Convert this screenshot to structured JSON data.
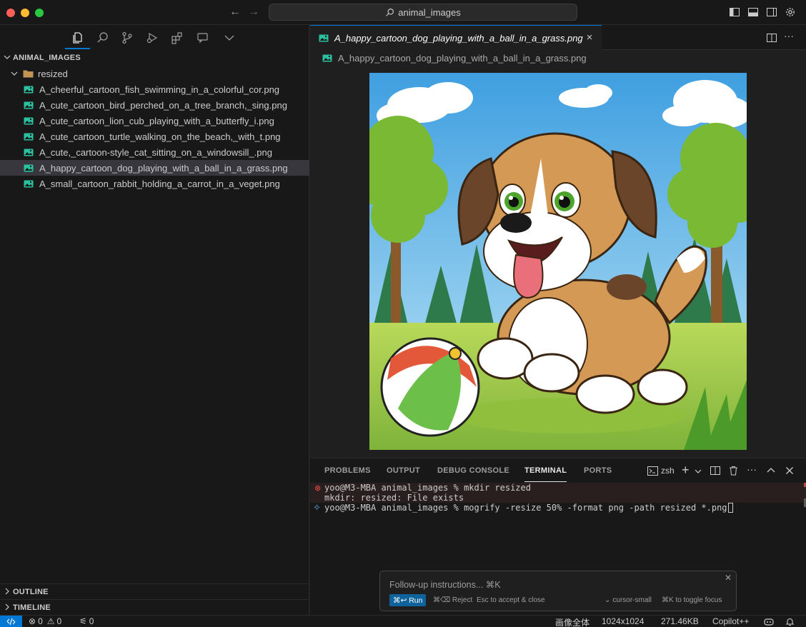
{
  "titlebar": {
    "search_text": "animal_images"
  },
  "sidebar": {
    "section_title": "ANIMAL_IMAGES",
    "folder": "resized",
    "files": [
      "A_cheerful_cartoon_fish_swimming_in_a_colorful_cor.png",
      "A_cute_cartoon_bird_perched_on_a_tree_branch,_sing.png",
      "A_cute_cartoon_lion_cub_playing_with_a_butterfly_i.png",
      "A_cute_cartoon_turtle_walking_on_the_beach,_with_t.png",
      "A_cute,_cartoon-style_cat_sitting_on_a_windowsill_.png",
      "A_happy_cartoon_dog_playing_with_a_ball_in_a_grass.png",
      "A_small_cartoon_rabbit_holding_a_carrot_in_a_veget.png"
    ],
    "selected_index": 5,
    "outline": "OUTLINE",
    "timeline": "TIMELINE"
  },
  "editor": {
    "tab_title": "A_happy_cartoon_dog_playing_with_a_ball_in_a_grass.png",
    "breadcrumb": "A_happy_cartoon_dog_playing_with_a_ball_in_a_grass.png"
  },
  "panel": {
    "tabs": [
      "PROBLEMS",
      "OUTPUT",
      "DEBUG CONSOLE",
      "TERMINAL",
      "PORTS"
    ],
    "active_tab": "TERMINAL",
    "shell": "zsh",
    "lines": [
      "yoo@M3-MBA animal_images % mkdir resized",
      "mkdir: resized: File exists",
      "yoo@M3-MBA animal_images % mogrify -resize 50% -format png -path resized *.png"
    ]
  },
  "followup": {
    "placeholder": "Follow-up instructions... ⌘K",
    "run": "⌘↩ Run",
    "reject": "⌘⌫ Reject",
    "esc": "Esc to accept & close",
    "model": "cursor-small",
    "toggle": "⌘K to toggle focus"
  },
  "statusbar": {
    "errors": "0",
    "warnings": "0",
    "ports": "0",
    "image_label": "画像全体",
    "dimensions": "1024x1024",
    "size": "271.46KB",
    "copilot": "Copilot++"
  },
  "colors": {
    "accent": "#0078d4",
    "image_icon": "#2bc0a0",
    "error": "#f14c4c"
  }
}
